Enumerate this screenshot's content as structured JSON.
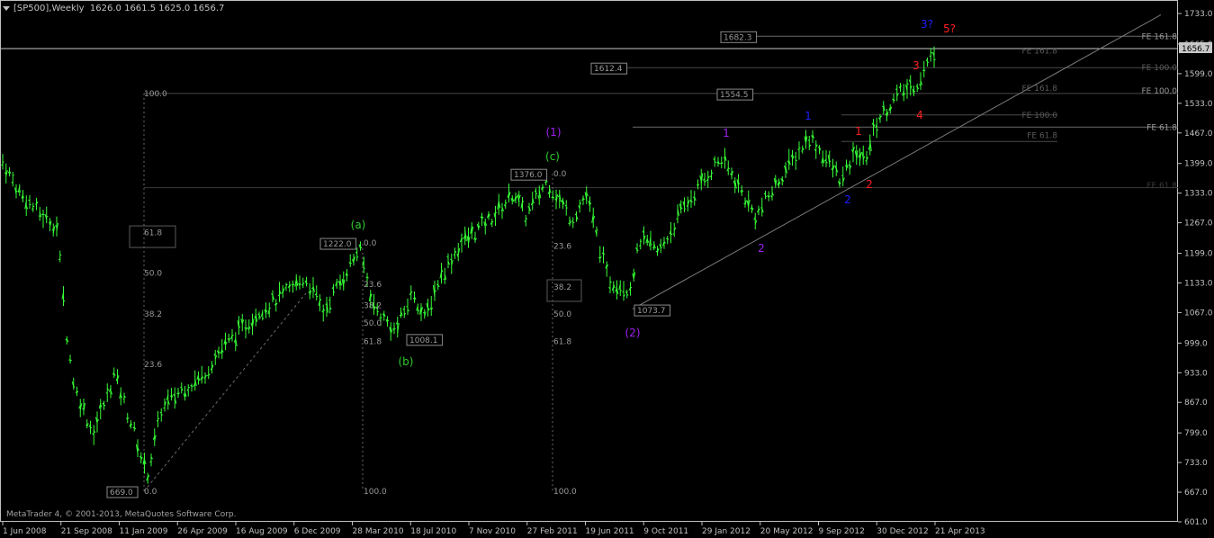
{
  "header": {
    "symbol_label": "[SP500],Weekly",
    "ohlc": "1626.0 1661.5 1625.0 1656.7"
  },
  "footer": {
    "copyright": "MetaTrader 4, © 2001-2013, MetaQuotes Software Corp."
  },
  "colors": {
    "background": "#000000",
    "bars": "#36ff36",
    "axis": "#c0c0c0",
    "wave_green": "#2ecc2e",
    "wave_purple": "#a020f0",
    "wave_blue": "#1f1fff",
    "wave_red": "#ff2020",
    "level_line": "#5a5a5a"
  },
  "chart_data": {
    "type": "ohlc-bar",
    "symbol": "[SP500]",
    "timeframe": "Weekly",
    "ylim": [
      601.0,
      1733.0
    ],
    "y_ticks": [
      "1733.0",
      "1665.0",
      "1599.0",
      "1533.0",
      "1467.0",
      "1399.0",
      "1333.0",
      "1267.0",
      "1199.0",
      "1133.0",
      "1067.0",
      "999.0",
      "933.0",
      "867.0",
      "799.0",
      "733.0",
      "667.0",
      "601.0"
    ],
    "x_ticks": [
      "1 Jun 2008",
      "21 Sep 2008",
      "11 Jan 2009",
      "26 Apr 2009",
      "16 Aug 2009",
      "6 Dec 2009",
      "28 Mar 2010",
      "18 Jul 2010",
      "7 Nov 2010",
      "27 Feb 2011",
      "19 Jun 2011",
      "9 Oct 2011",
      "29 Jan 2012",
      "20 May 2012",
      "9 Sep 2012",
      "30 Dec 2012",
      "21 Apr 2013"
    ],
    "last_price": "1656.7",
    "price_boxes": [
      "669.0",
      "1222.0",
      "1008.1",
      "1376.0",
      "1073.7",
      "1612.4",
      "1554.5",
      "1682.3"
    ],
    "fib_labels": {
      "retr_1": [
        "100.0",
        "61.8",
        "50.0",
        "38.2",
        "23.6",
        "0.0"
      ],
      "retr_a": [
        "0.0",
        "23.6",
        "38.2",
        "50.0",
        "61.8",
        "100.0"
      ],
      "retr_2": [
        "0.0",
        "23.6",
        "38.2",
        "50.0",
        "61.8",
        "100.0"
      ],
      "fe": [
        "FE 161.8",
        "FE 161.8",
        "FE 100.0",
        "FE 161.8",
        "FE 100.0",
        "FE 100.0",
        "FE 61.8",
        "FE 61.8",
        "FE 61.8"
      ]
    },
    "wave_labels": [
      "(a)",
      "(b)",
      "(c)",
      "(1)",
      "(2)",
      "1",
      "2",
      "1",
      "2",
      "1",
      "2",
      "3",
      "4",
      "3?",
      "5?"
    ],
    "anchors": [
      [
        "2008-06-01",
        1403
      ],
      [
        "2008-07-06",
        1330
      ],
      [
        "2008-08-10",
        1290
      ],
      [
        "2008-09-14",
        1260
      ],
      [
        "2008-10-05",
        1000
      ],
      [
        "2008-10-19",
        900
      ],
      [
        "2008-11-23",
        800
      ],
      [
        "2008-12-21",
        880
      ],
      [
        "2009-01-04",
        930
      ],
      [
        "2009-02-15",
        790
      ],
      [
        "2009-03-08",
        700
      ],
      [
        "2009-04-05",
        850
      ],
      [
        "2009-05-17",
        900
      ],
      [
        "2009-06-21",
        920
      ],
      [
        "2009-07-26",
        980
      ],
      [
        "2009-08-30",
        1020
      ],
      [
        "2009-10-11",
        1070
      ],
      [
        "2009-11-22",
        1100
      ],
      [
        "2010-01-10",
        1145
      ],
      [
        "2010-02-14",
        1070
      ],
      [
        "2010-04-25",
        1210
      ],
      [
        "2010-05-23",
        1080
      ],
      [
        "2010-07-04",
        1025
      ],
      [
        "2010-08-08",
        1115
      ],
      [
        "2010-08-29",
        1050
      ],
      [
        "2010-09-26",
        1140
      ],
      [
        "2010-11-07",
        1220
      ],
      [
        "2011-01-09",
        1280
      ],
      [
        "2011-02-20",
        1335
      ],
      [
        "2011-03-13",
        1280
      ],
      [
        "2011-04-24",
        1360
      ],
      [
        "2011-06-12",
        1275
      ],
      [
        "2011-07-10",
        1330
      ],
      [
        "2011-08-21",
        1140
      ],
      [
        "2011-10-02",
        1120
      ],
      [
        "2011-10-23",
        1230
      ],
      [
        "2011-11-27",
        1200
      ],
      [
        "2012-01-15",
        1300
      ],
      [
        "2012-03-25",
        1410
      ],
      [
        "2012-04-15",
        1380
      ],
      [
        "2012-06-03",
        1280
      ],
      [
        "2012-07-22",
        1370
      ],
      [
        "2012-09-16",
        1460
      ],
      [
        "2012-11-18",
        1360
      ],
      [
        "2012-12-16",
        1430
      ],
      [
        "2012-12-30",
        1402
      ],
      [
        "2013-01-27",
        1500
      ],
      [
        "2013-03-10",
        1555
      ],
      [
        "2013-04-14",
        1580
      ],
      [
        "2013-05-19",
        1656
      ]
    ]
  }
}
